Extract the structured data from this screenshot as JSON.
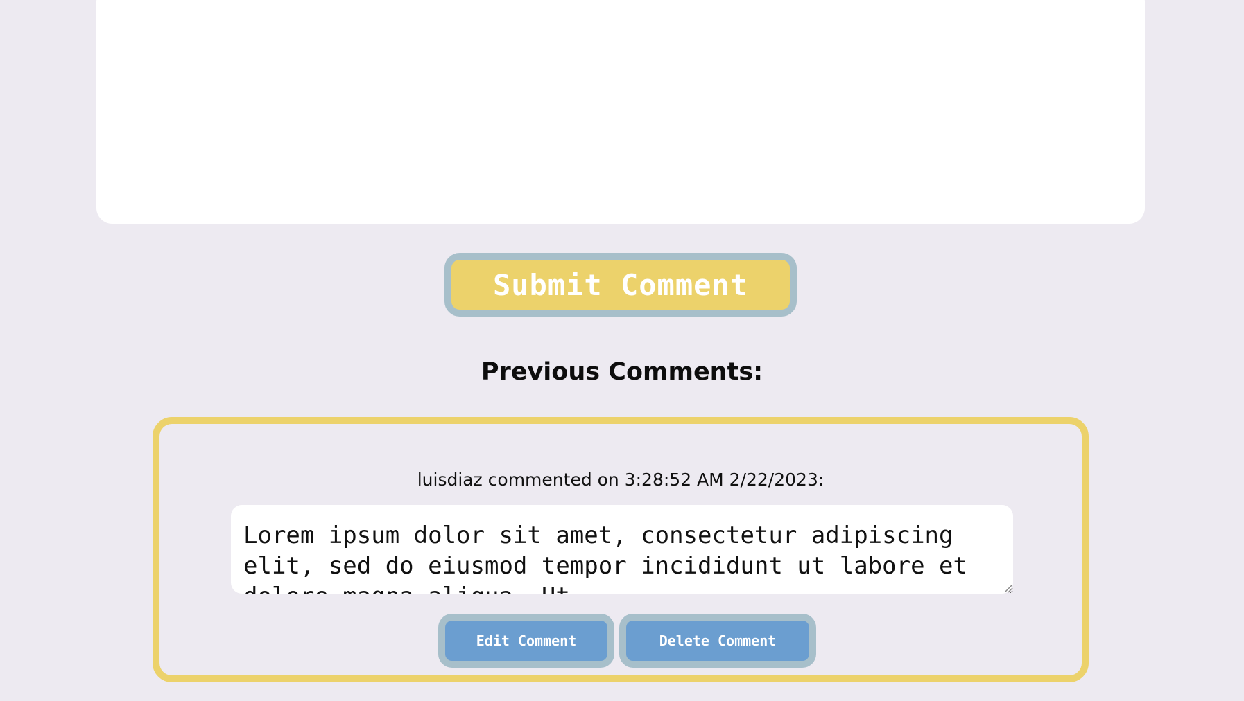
{
  "editor": {
    "submit_label": "Submit Comment"
  },
  "comments": {
    "heading": "Previous Comments:",
    "items": [
      {
        "meta": "luisdiaz commented on 3:28:52 AM 2/22/2023:",
        "body": "Lorem ipsum dolor sit amet, consectetur adipiscing elit, sed do eiusmod tempor incididunt ut labore et dolore magna aliqua. Ut",
        "edit_label": "Edit Comment",
        "delete_label": "Delete Comment"
      }
    ]
  },
  "colors": {
    "page_background": "#edeaf1",
    "accent_yellow": "#ecd26b",
    "button_blue": "#6b9ed0",
    "button_border": "#a7bfca"
  }
}
